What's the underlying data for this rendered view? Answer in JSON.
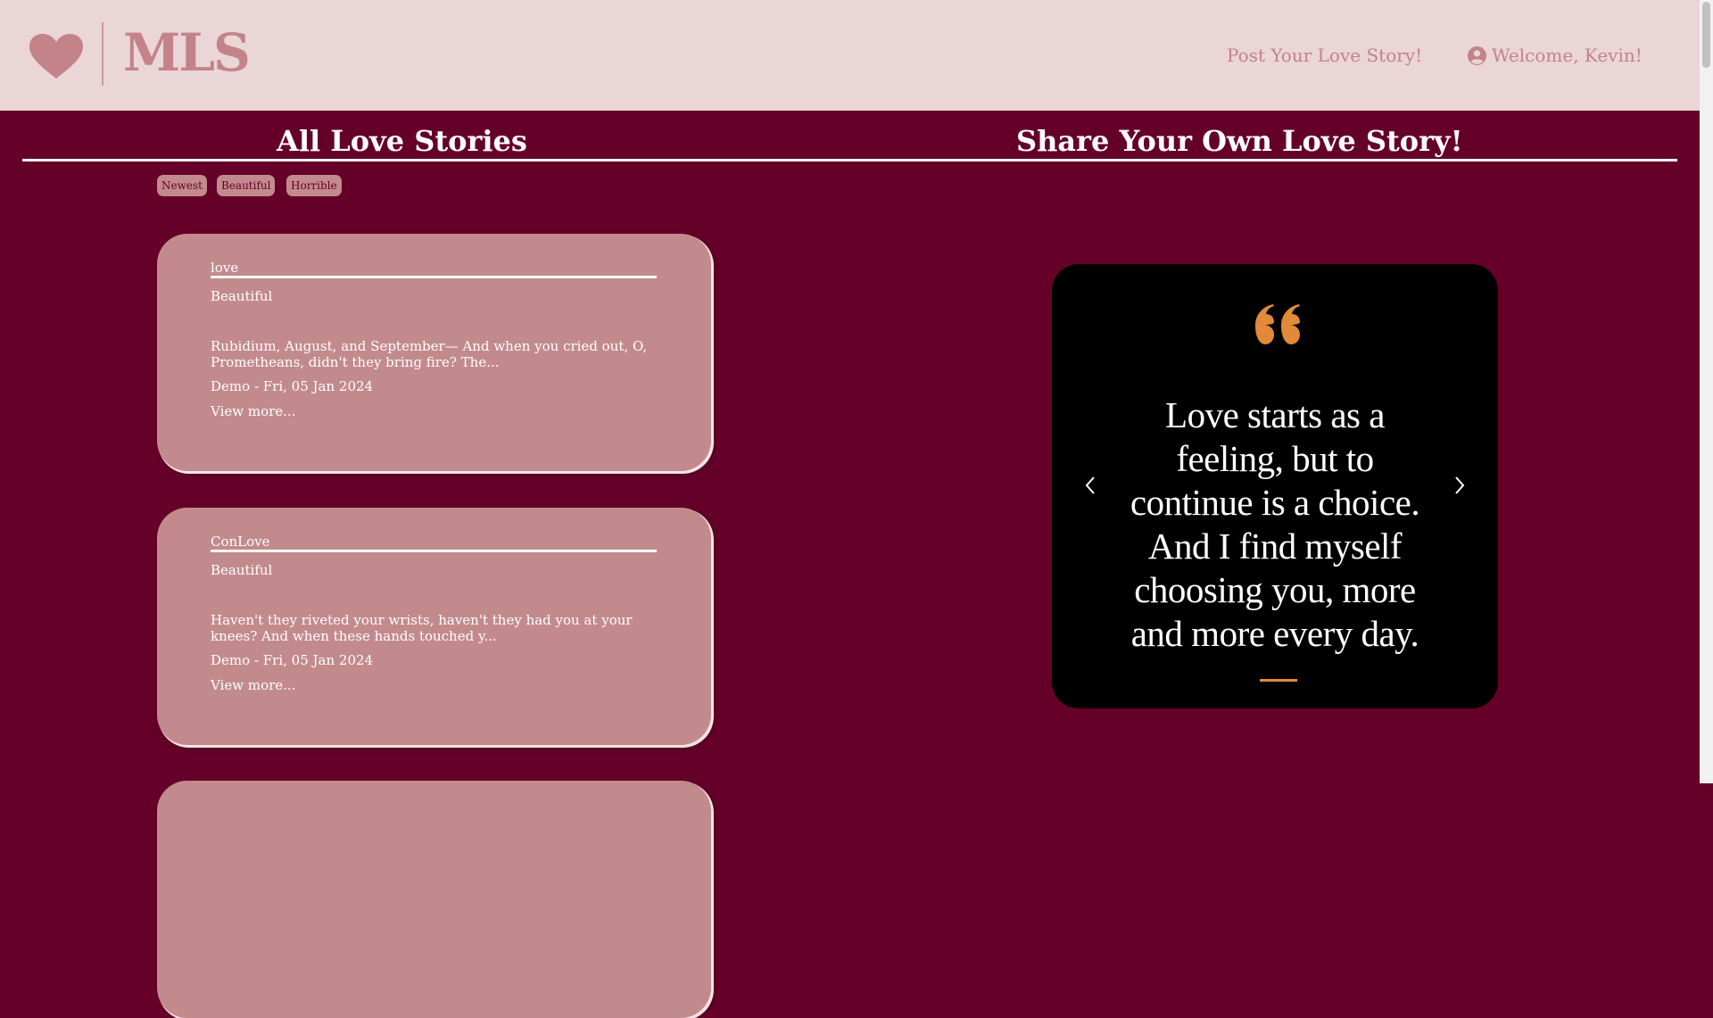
{
  "header": {
    "logo_text": "MLS",
    "post_link": "Post Your Love Story!",
    "welcome": "Welcome, Kevin!",
    "logo_icon": "heart-icon",
    "user_icon": "user-circle-icon"
  },
  "sections": {
    "left_title": "All Love Stories",
    "right_title": "Share Your Own Love Story!"
  },
  "filters": [
    "Newest",
    "Beautiful",
    "Horrible"
  ],
  "stories": [
    {
      "title": "love",
      "category": "Beautiful",
      "excerpt": "Rubidium, August, and September— And when you cried out, O, Prometheans, didn't they bring fire? The...",
      "meta": "Demo - Fri, 05 Jan 2024",
      "more": "View more..."
    },
    {
      "title": "ConLove",
      "category": "Beautiful",
      "excerpt": "Haven't they riveted your wrists, haven't they had you at your knees? And when these hands touched y...",
      "meta": "Demo - Fri, 05 Jan 2024",
      "more": "View more..."
    }
  ],
  "quote": {
    "text": "Love starts as a feeling, but to continue is a choice. And I find myself choosing you, more and more every day.",
    "prev_icon": "chevron-left-icon",
    "next_icon": "chevron-right-icon",
    "quote_icon": "quote-icon"
  },
  "colors": {
    "background": "#650028",
    "header_bg": "#ead5d7",
    "accent_pink": "#c38389",
    "card_bg": "#c38a8d",
    "quote_bg": "#000000",
    "quote_accent": "#e08a3a"
  }
}
